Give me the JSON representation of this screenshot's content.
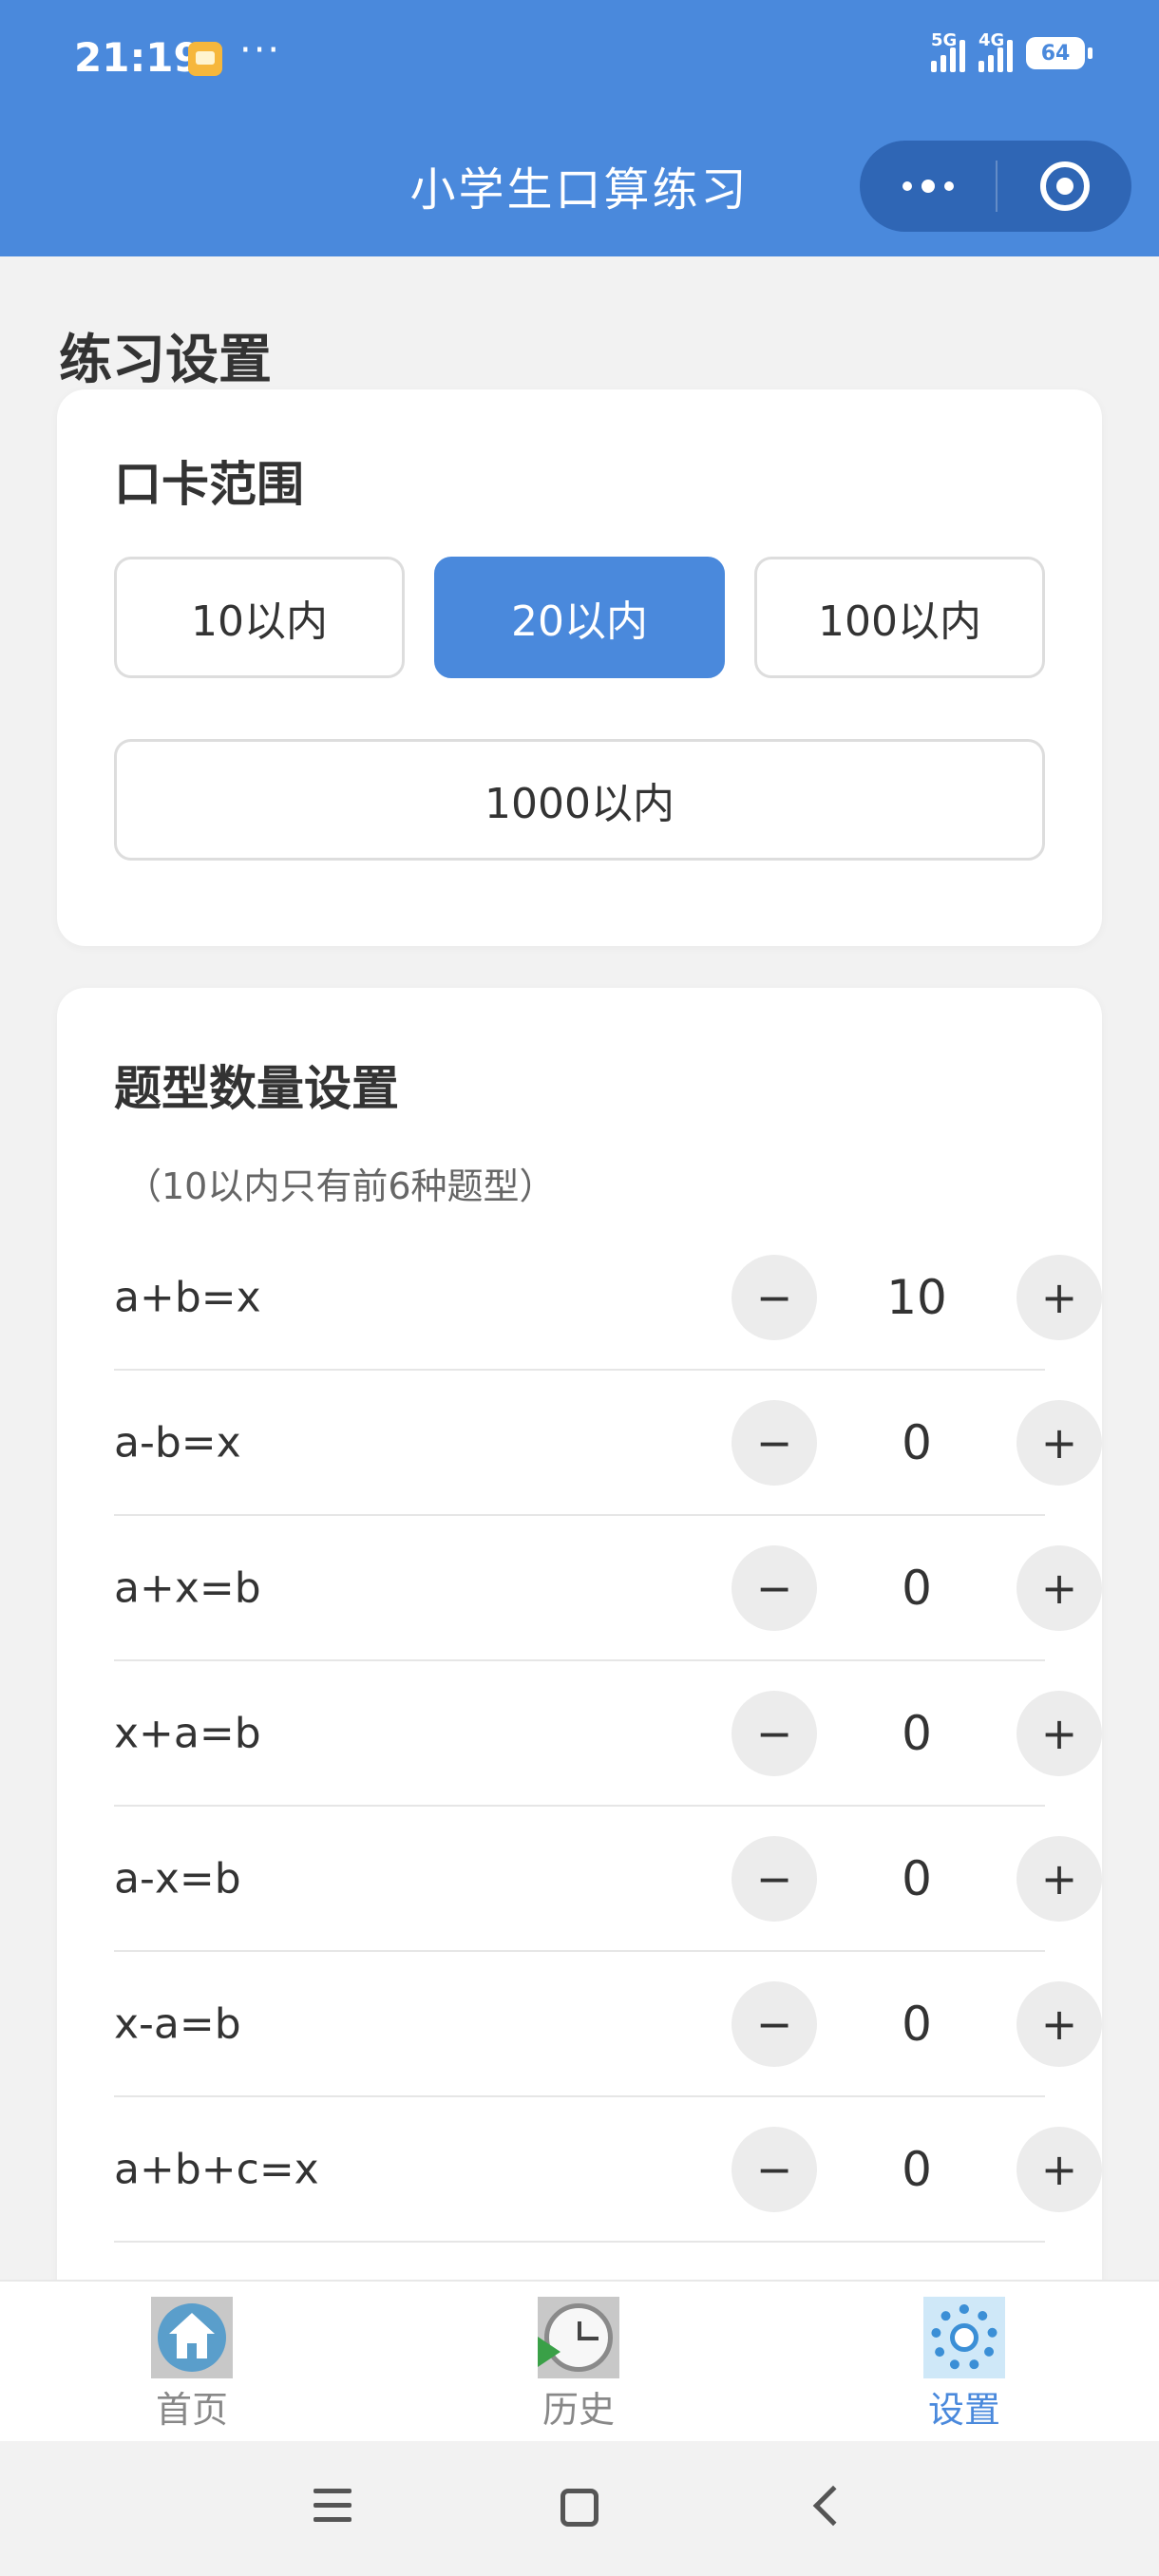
{
  "status_bar": {
    "time": "21:19",
    "dots": "···",
    "signal1_label": "5G",
    "signal2_label": "4G",
    "battery": "64"
  },
  "header": {
    "title": "小学生口算练习",
    "more_icon": "more-dots-icon",
    "close_icon": "target-icon"
  },
  "section_title": "练习设置",
  "range_card": {
    "title": "口卡范围",
    "options": [
      "10以内",
      "20以内",
      "100以内",
      "1000以内"
    ],
    "selected": "20以内"
  },
  "types_card": {
    "title": "题型数量设置",
    "note": "（10以内只有前6种题型）",
    "minus_label": "−",
    "plus_label": "+",
    "rows": [
      {
        "expr": "a+b=x",
        "count": "10"
      },
      {
        "expr": "a-b=x",
        "count": "0"
      },
      {
        "expr": "a+x=b",
        "count": "0"
      },
      {
        "expr": "x+a=b",
        "count": "0"
      },
      {
        "expr": "a-x=b",
        "count": "0"
      },
      {
        "expr": "x-a=b",
        "count": "0"
      },
      {
        "expr": "a+b+c=x",
        "count": "0"
      }
    ]
  },
  "tabbar": {
    "tabs": [
      {
        "label": "首页",
        "icon": "home-icon"
      },
      {
        "label": "历史",
        "icon": "history-clock-icon"
      },
      {
        "label": "设置",
        "icon": "settings-gear-icon"
      }
    ],
    "active": "设置",
    "active_color": "#4a89dc"
  },
  "colors": {
    "primary": "#4a89dc",
    "background": "#f2f2f2"
  }
}
